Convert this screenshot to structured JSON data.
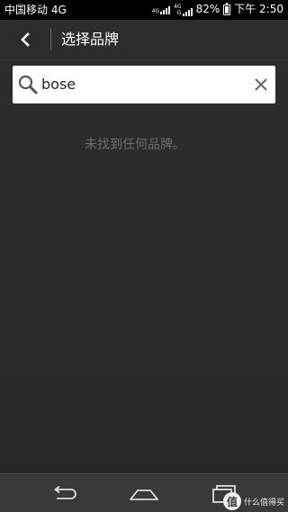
{
  "status_bar": {
    "carrier": "中国移动 4G",
    "net1": "4G",
    "net2": "4G",
    "net2_sub": "G",
    "battery": "82%",
    "time": "下午 2:50"
  },
  "header": {
    "title": "选择品牌"
  },
  "search": {
    "value": "bose"
  },
  "empty_message": "未找到任何品牌。",
  "watermark": {
    "badge": "值",
    "text": "什么值得买"
  },
  "colors": {
    "background": "#2b2b2b",
    "status_bar": "#000000",
    "nav_bar": "#3a3a3a",
    "muted_text": "#6e6e6e"
  },
  "icons": {
    "back": "chevron-left-icon",
    "search": "search-icon",
    "clear": "close-icon",
    "nav_back": "return-arrow-icon",
    "nav_home": "home-icon",
    "nav_recent": "recent-apps-icon"
  }
}
